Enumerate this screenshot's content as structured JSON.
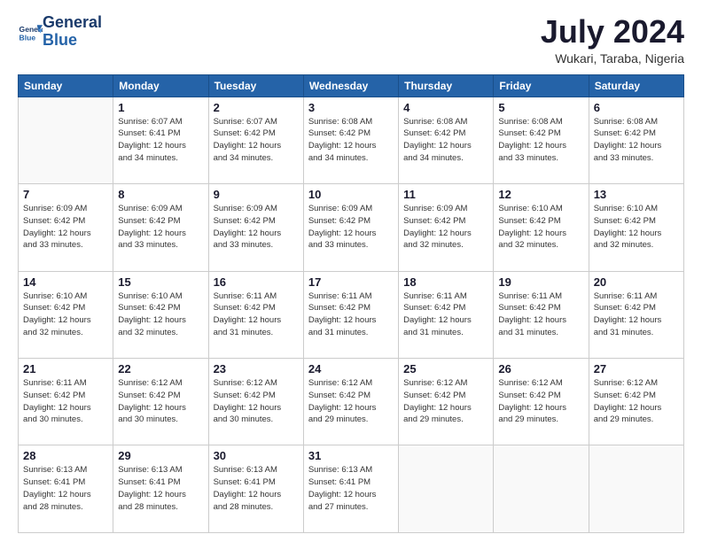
{
  "logo": {
    "line1": "General",
    "line2": "Blue"
  },
  "title": "July 2024",
  "location": "Wukari, Taraba, Nigeria",
  "weekdays": [
    "Sunday",
    "Monday",
    "Tuesday",
    "Wednesday",
    "Thursday",
    "Friday",
    "Saturday"
  ],
  "weeks": [
    [
      {
        "day": "",
        "info": ""
      },
      {
        "day": "1",
        "info": "Sunrise: 6:07 AM\nSunset: 6:41 PM\nDaylight: 12 hours\nand 34 minutes."
      },
      {
        "day": "2",
        "info": "Sunrise: 6:07 AM\nSunset: 6:42 PM\nDaylight: 12 hours\nand 34 minutes."
      },
      {
        "day": "3",
        "info": "Sunrise: 6:08 AM\nSunset: 6:42 PM\nDaylight: 12 hours\nand 34 minutes."
      },
      {
        "day": "4",
        "info": "Sunrise: 6:08 AM\nSunset: 6:42 PM\nDaylight: 12 hours\nand 34 minutes."
      },
      {
        "day": "5",
        "info": "Sunrise: 6:08 AM\nSunset: 6:42 PM\nDaylight: 12 hours\nand 33 minutes."
      },
      {
        "day": "6",
        "info": "Sunrise: 6:08 AM\nSunset: 6:42 PM\nDaylight: 12 hours\nand 33 minutes."
      }
    ],
    [
      {
        "day": "7",
        "info": "Sunrise: 6:09 AM\nSunset: 6:42 PM\nDaylight: 12 hours\nand 33 minutes."
      },
      {
        "day": "8",
        "info": "Sunrise: 6:09 AM\nSunset: 6:42 PM\nDaylight: 12 hours\nand 33 minutes."
      },
      {
        "day": "9",
        "info": "Sunrise: 6:09 AM\nSunset: 6:42 PM\nDaylight: 12 hours\nand 33 minutes."
      },
      {
        "day": "10",
        "info": "Sunrise: 6:09 AM\nSunset: 6:42 PM\nDaylight: 12 hours\nand 33 minutes."
      },
      {
        "day": "11",
        "info": "Sunrise: 6:09 AM\nSunset: 6:42 PM\nDaylight: 12 hours\nand 32 minutes."
      },
      {
        "day": "12",
        "info": "Sunrise: 6:10 AM\nSunset: 6:42 PM\nDaylight: 12 hours\nand 32 minutes."
      },
      {
        "day": "13",
        "info": "Sunrise: 6:10 AM\nSunset: 6:42 PM\nDaylight: 12 hours\nand 32 minutes."
      }
    ],
    [
      {
        "day": "14",
        "info": "Sunrise: 6:10 AM\nSunset: 6:42 PM\nDaylight: 12 hours\nand 32 minutes."
      },
      {
        "day": "15",
        "info": "Sunrise: 6:10 AM\nSunset: 6:42 PM\nDaylight: 12 hours\nand 32 minutes."
      },
      {
        "day": "16",
        "info": "Sunrise: 6:11 AM\nSunset: 6:42 PM\nDaylight: 12 hours\nand 31 minutes."
      },
      {
        "day": "17",
        "info": "Sunrise: 6:11 AM\nSunset: 6:42 PM\nDaylight: 12 hours\nand 31 minutes."
      },
      {
        "day": "18",
        "info": "Sunrise: 6:11 AM\nSunset: 6:42 PM\nDaylight: 12 hours\nand 31 minutes."
      },
      {
        "day": "19",
        "info": "Sunrise: 6:11 AM\nSunset: 6:42 PM\nDaylight: 12 hours\nand 31 minutes."
      },
      {
        "day": "20",
        "info": "Sunrise: 6:11 AM\nSunset: 6:42 PM\nDaylight: 12 hours\nand 31 minutes."
      }
    ],
    [
      {
        "day": "21",
        "info": "Sunrise: 6:11 AM\nSunset: 6:42 PM\nDaylight: 12 hours\nand 30 minutes."
      },
      {
        "day": "22",
        "info": "Sunrise: 6:12 AM\nSunset: 6:42 PM\nDaylight: 12 hours\nand 30 minutes."
      },
      {
        "day": "23",
        "info": "Sunrise: 6:12 AM\nSunset: 6:42 PM\nDaylight: 12 hours\nand 30 minutes."
      },
      {
        "day": "24",
        "info": "Sunrise: 6:12 AM\nSunset: 6:42 PM\nDaylight: 12 hours\nand 29 minutes."
      },
      {
        "day": "25",
        "info": "Sunrise: 6:12 AM\nSunset: 6:42 PM\nDaylight: 12 hours\nand 29 minutes."
      },
      {
        "day": "26",
        "info": "Sunrise: 6:12 AM\nSunset: 6:42 PM\nDaylight: 12 hours\nand 29 minutes."
      },
      {
        "day": "27",
        "info": "Sunrise: 6:12 AM\nSunset: 6:42 PM\nDaylight: 12 hours\nand 29 minutes."
      }
    ],
    [
      {
        "day": "28",
        "info": "Sunrise: 6:13 AM\nSunset: 6:41 PM\nDaylight: 12 hours\nand 28 minutes."
      },
      {
        "day": "29",
        "info": "Sunrise: 6:13 AM\nSunset: 6:41 PM\nDaylight: 12 hours\nand 28 minutes."
      },
      {
        "day": "30",
        "info": "Sunrise: 6:13 AM\nSunset: 6:41 PM\nDaylight: 12 hours\nand 28 minutes."
      },
      {
        "day": "31",
        "info": "Sunrise: 6:13 AM\nSunset: 6:41 PM\nDaylight: 12 hours\nand 27 minutes."
      },
      {
        "day": "",
        "info": ""
      },
      {
        "day": "",
        "info": ""
      },
      {
        "day": "",
        "info": ""
      }
    ]
  ]
}
